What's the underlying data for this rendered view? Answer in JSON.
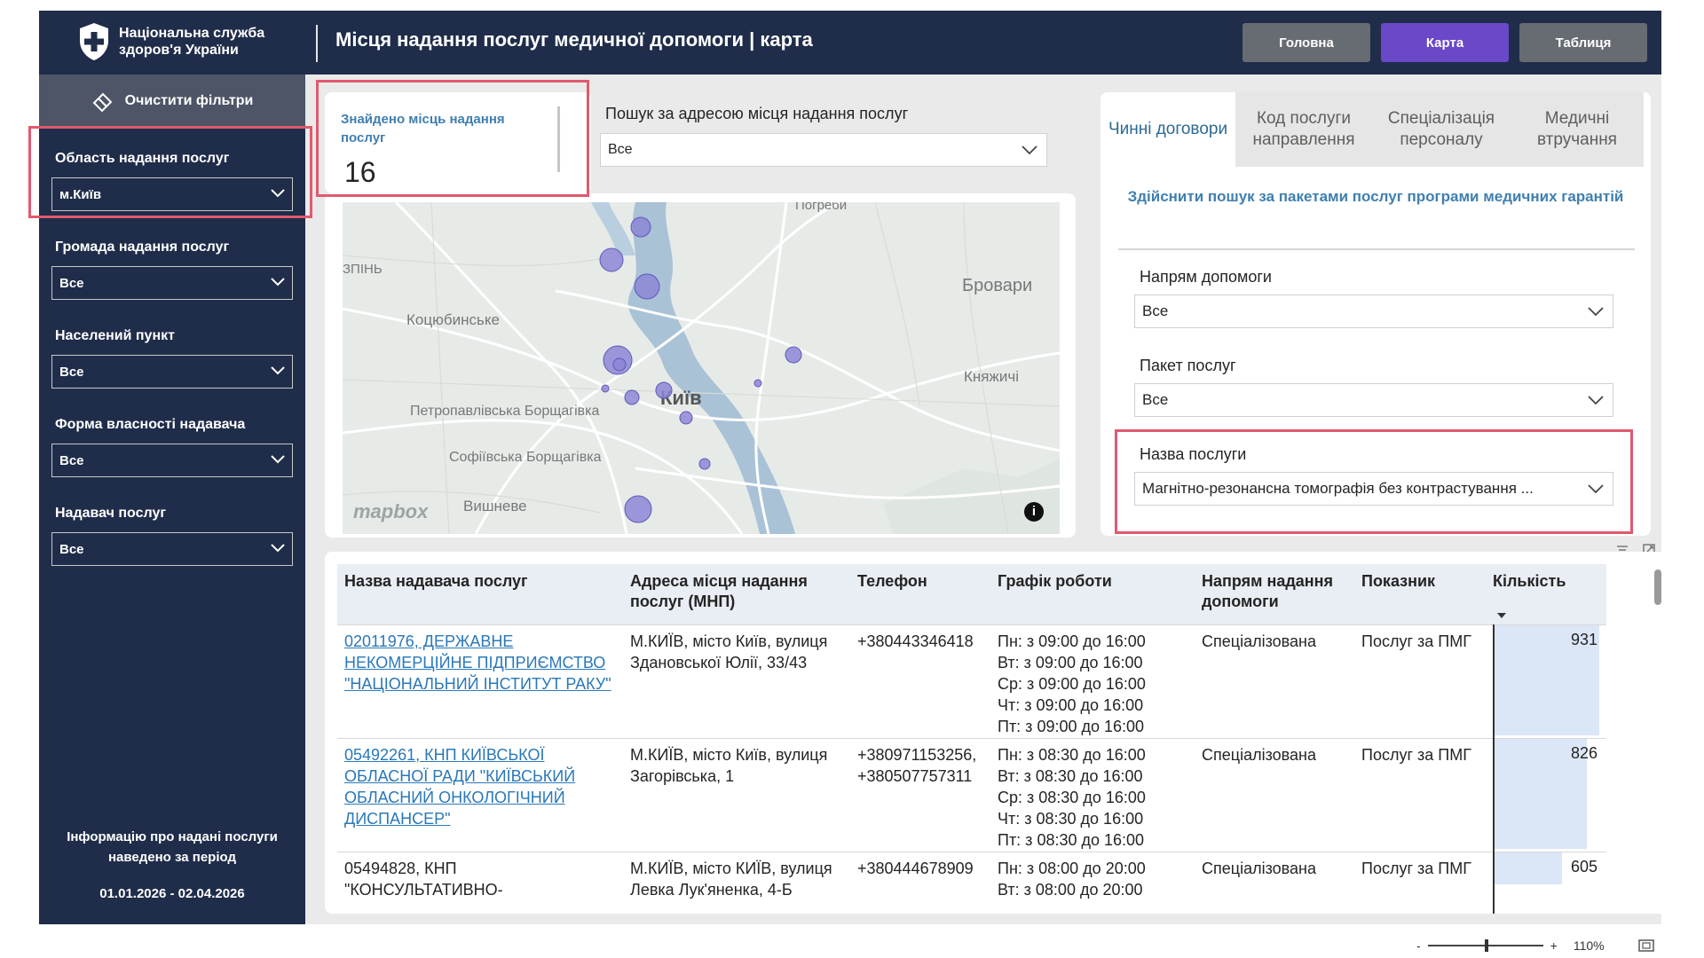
{
  "header": {
    "org_name": "Національна служба здоров'я України",
    "title": "Місця надання послуг медичної допомоги | карта",
    "nav": [
      {
        "label": "Головна",
        "active": false
      },
      {
        "label": "Карта",
        "active": true
      },
      {
        "label": "Таблиця",
        "active": false
      }
    ],
    "colors": {
      "bg": "#1f2d4a",
      "active": "#6a48c8",
      "inactive": "#676b72"
    }
  },
  "sidebar": {
    "clear_filters": "Очистити фільтри",
    "filters": [
      {
        "label": "Область надання послуг",
        "value": "м.Київ"
      },
      {
        "label": "Громада надання послуг",
        "value": "Все"
      },
      {
        "label": "Населений пункт",
        "value": "Все"
      },
      {
        "label": "Форма власності надавача",
        "value": "Все"
      },
      {
        "label": "Надавач послуг",
        "value": "Все"
      }
    ],
    "info": "Інформацію про надані послуги наведено за період",
    "period": "01.01.2026 - 02.04.2026"
  },
  "found": {
    "label": "Знайдено місць надання послуг",
    "value": "16"
  },
  "search": {
    "label": "Пошук за адресою місця надання послуг",
    "value": "Все"
  },
  "map": {
    "labels": [
      "Погреби",
      "Бровари",
      "Коцюбинське",
      "Київ",
      "Княжичі",
      "Петропавлівська Борщагівка",
      "Софіївська Борщагівка",
      "Вишневе",
      "ЗПІНЬ"
    ],
    "attribution": "mapbox",
    "point_color": "#8d86d6"
  },
  "right": {
    "tabs": [
      "Чинні договори",
      "Код послуги направлення",
      "Спеціалізація персоналу",
      "Медичні втручання"
    ],
    "heading": "Здійснити пошук за пакетами послуг програми медичних гарантій",
    "filters": [
      {
        "label": "Напрям допомоги",
        "value": "Все"
      },
      {
        "label": "Пакет послуг",
        "value": "Все"
      },
      {
        "label": "Назва послуги",
        "value": "Магнітно-резонансна томографія без контрастування ..."
      }
    ]
  },
  "table": {
    "columns": [
      "Назва надавача послуг",
      "Адреса місця надання послуг (МНП)",
      "Телефон",
      "Графік роботи",
      "Напрям надання допомоги",
      "Показник",
      "Кількість"
    ],
    "rows": [
      {
        "provider": "02011976, ДЕРЖАВНЕ НЕКОМЕРЦІЙНЕ ПІДПРИЄМСТВО \"НАЦІОНАЛЬНИЙ ІНСТИТУТ РАКУ\"",
        "provider_lines": [
          "02011976, ДЕРЖАВНЕ",
          "НЕКОМЕРЦІЙНЕ ПІДПРИЄМСТВО",
          "\"НАЦІОНАЛЬНИЙ ІНСТИТУТ РАКУ\""
        ],
        "address_lines": [
          "М.КИЇВ, місто Київ, вулиця",
          "Здановської Юлії, 33/43"
        ],
        "phone_lines": [
          "+380443346418"
        ],
        "schedule": [
          "Пн: з 09:00 до 16:00",
          "Вт: з 09:00 до 16:00",
          "Ср: з 09:00 до 16:00",
          "Чт: з 09:00 до 16:00",
          "Пт: з 09:00 до 16:00"
        ],
        "direction": "Спеціалізована",
        "indicator": "Послуг за ПМГ",
        "quantity": 931,
        "is_link": true
      },
      {
        "provider": "05492261, КНП КИЇВСЬКОЇ ОБЛАСНОЇ РАДИ \"КИЇВСЬКИЙ ОБЛАСНИЙ ОНКОЛОГІЧНИЙ ДИСПАНСЕР\"",
        "provider_lines": [
          "05492261, КНП КИЇВСЬКОЇ",
          "ОБЛАСНОЇ РАДИ \"КИЇВСЬКИЙ",
          "ОБЛАСНИЙ ОНКОЛОГІЧНИЙ",
          "ДИСПАНСЕР\""
        ],
        "address_lines": [
          "М.КИЇВ, місто Київ, вулиця",
          "Загорівська, 1"
        ],
        "phone_lines": [
          "+380971153256,",
          "+380507757311"
        ],
        "schedule": [
          "Пн: з 08:30 до 16:00",
          "Вт: з 08:30 до 16:00",
          "Ср: з 08:30 до 16:00",
          "Чт: з 08:30 до 16:00",
          "Пт: з 08:30 до 16:00"
        ],
        "direction": "Спеціалізована",
        "indicator": "Послуг за ПМГ",
        "quantity": 826,
        "is_link": true
      },
      {
        "provider": "05494828, КНП \"КОНСУЛЬТАТИВНО-",
        "provider_lines": [
          "05494828, КНП",
          "\"КОНСУЛЬТАТИВНО-"
        ],
        "address_lines": [
          "М.КИЇВ, місто КИЇВ, вулиця",
          "Левка Лук'яненка, 4-Б"
        ],
        "phone_lines": [
          "+380444678909"
        ],
        "schedule": [
          "Пн: з 08:00 до 20:00",
          "Вт: з 08:00 до 20:00"
        ],
        "direction": "Спеціалізована",
        "indicator": "Послуг за ПМГ",
        "quantity": 605,
        "is_link": false
      }
    ]
  },
  "footer": {
    "zoom_minus": "-",
    "zoom_plus": "+",
    "zoom_level": "110%"
  }
}
